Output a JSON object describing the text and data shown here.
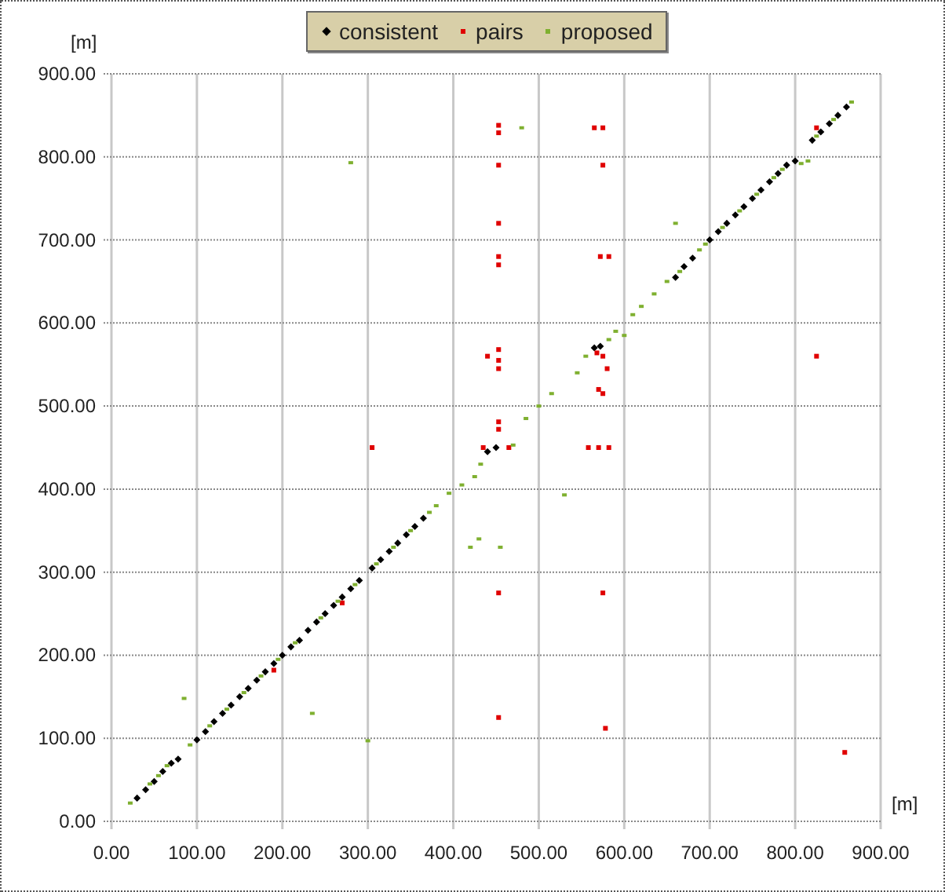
{
  "chart_data": {
    "type": "scatter",
    "grid": true,
    "legend": "top",
    "xlabel": "[m]",
    "ylabel": "[m]",
    "xlim": [
      0,
      900
    ],
    "ylim": [
      0,
      900
    ],
    "xticks": [
      {
        "value": 0,
        "label": "0.00"
      },
      {
        "value": 100,
        "label": "100.00"
      },
      {
        "value": 200,
        "label": "200.00"
      },
      {
        "value": 300,
        "label": "300.00"
      },
      {
        "value": 400,
        "label": "400.00"
      },
      {
        "value": 500,
        "label": "500.00"
      },
      {
        "value": 600,
        "label": "600.00"
      },
      {
        "value": 700,
        "label": "700.00"
      },
      {
        "value": 800,
        "label": "800.00"
      },
      {
        "value": 900,
        "label": "900.00"
      }
    ],
    "yticks": [
      {
        "value": 0,
        "label": "0.00"
      },
      {
        "value": 100,
        "label": "100.00"
      },
      {
        "value": 200,
        "label": "200.00"
      },
      {
        "value": 300,
        "label": "300.00"
      },
      {
        "value": 400,
        "label": "400.00"
      },
      {
        "value": 500,
        "label": "500.00"
      },
      {
        "value": 600,
        "label": "600.00"
      },
      {
        "value": 700,
        "label": "700.00"
      },
      {
        "value": 800,
        "label": "800.00"
      },
      {
        "value": 900,
        "label": "900.00"
      }
    ],
    "series": [
      {
        "name": "consistent",
        "color": "#000000",
        "x": [
          30,
          40,
          50,
          60,
          70,
          78,
          100,
          110,
          120,
          130,
          140,
          150,
          160,
          170,
          180,
          190,
          200,
          210,
          220,
          230,
          240,
          250,
          260,
          270,
          280,
          290,
          305,
          315,
          325,
          335,
          345,
          355,
          365,
          440,
          450,
          565,
          572,
          660,
          670,
          680,
          700,
          710,
          720,
          730,
          740,
          750,
          760,
          770,
          780,
          790,
          800,
          820,
          830,
          840,
          850,
          860
        ],
        "values": [
          28,
          38,
          48,
          60,
          70,
          75,
          98,
          108,
          120,
          130,
          140,
          150,
          160,
          170,
          180,
          190,
          200,
          210,
          218,
          230,
          240,
          250,
          260,
          270,
          280,
          290,
          305,
          315,
          325,
          335,
          345,
          355,
          365,
          445,
          450,
          570,
          572,
          655,
          668,
          678,
          700,
          710,
          720,
          730,
          740,
          750,
          760,
          770,
          780,
          790,
          795,
          820,
          830,
          840,
          850,
          860
        ]
      },
      {
        "name": "pairs",
        "color": "#e00000",
        "x": [
          453,
          453,
          453,
          453,
          453,
          453,
          453,
          453,
          453,
          440,
          453,
          453,
          453,
          453,
          305,
          565,
          575,
          575,
          572,
          582,
          575,
          580,
          570,
          575,
          558,
          570,
          582,
          575,
          578,
          825,
          858,
          825,
          435,
          465,
          190,
          270,
          568
        ],
        "values": [
          838,
          829,
          790,
          720,
          680,
          670,
          568,
          555,
          545,
          560,
          481,
          472,
          275,
          125,
          450,
          835,
          835,
          790,
          680,
          680,
          560,
          545,
          520,
          515,
          450,
          450,
          450,
          275,
          112,
          560,
          83,
          835,
          450,
          450,
          182,
          263,
          564
        ]
      },
      {
        "name": "proposed",
        "color": "#7fb030",
        "x": [
          22,
          45,
          55,
          65,
          85,
          92,
          115,
          135,
          155,
          175,
          195,
          215,
          235,
          245,
          265,
          285,
          280,
          300,
          310,
          330,
          350,
          372,
          380,
          395,
          410,
          420,
          425,
          430,
          432,
          455,
          470,
          480,
          485,
          500,
          515,
          530,
          545,
          555,
          582,
          590,
          600,
          610,
          620,
          635,
          650,
          660,
          665,
          688,
          695,
          715,
          735,
          755,
          775,
          785,
          807,
          815,
          825,
          845,
          866
        ],
        "values": [
          22,
          45,
          55,
          67,
          148,
          92,
          115,
          135,
          155,
          175,
          195,
          215,
          130,
          245,
          265,
          285,
          793,
          97,
          310,
          330,
          350,
          372,
          380,
          395,
          405,
          330,
          415,
          340,
          430,
          330,
          453,
          835,
          485,
          500,
          515,
          393,
          540,
          560,
          580,
          590,
          585,
          610,
          620,
          635,
          650,
          720,
          662,
          688,
          695,
          715,
          735,
          755,
          775,
          785,
          792,
          795,
          825,
          845,
          866
        ]
      }
    ]
  }
}
